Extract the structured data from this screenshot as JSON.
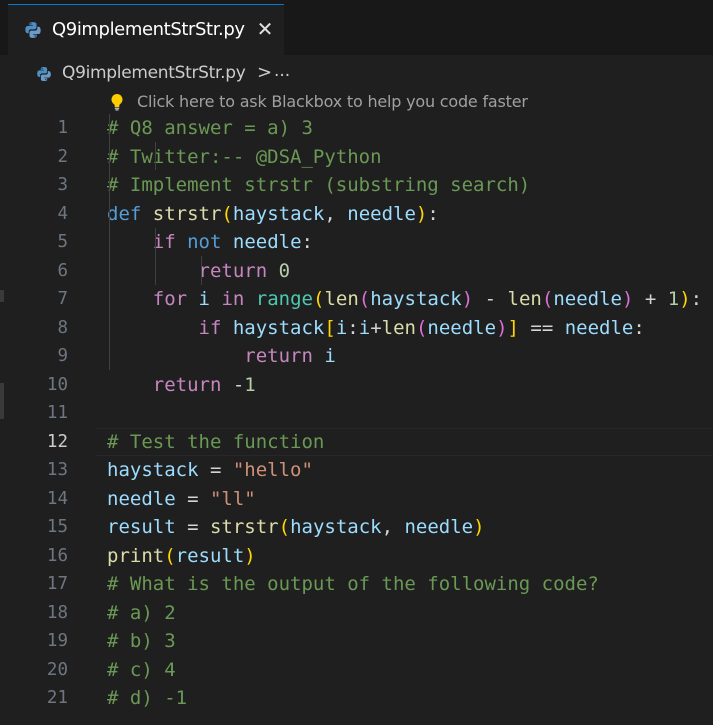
{
  "tab": {
    "filename": "Q9implementStrStr.py",
    "close_glyph": "✕"
  },
  "breadcrumb": {
    "filename": "Q9implementStrStr.py",
    "separator": ">",
    "more": "..."
  },
  "codelens": {
    "text": "Click here to ask Blackbox to help you code faster",
    "icon": "lightbulb-icon"
  },
  "editor": {
    "current_line": 12,
    "lines": [
      {
        "n": "1",
        "tokens": [
          {
            "t": "# Q8 answer = a) 3",
            "c": "cm"
          }
        ]
      },
      {
        "n": "2",
        "tokens": [
          {
            "t": "# Twitter:-- @DSA_Python",
            "c": "cm"
          }
        ]
      },
      {
        "n": "3",
        "tokens": [
          {
            "t": "# Implement strstr (substring search)",
            "c": "cm"
          }
        ]
      },
      {
        "n": "4",
        "tokens": [
          {
            "t": "def",
            "c": "kw"
          },
          {
            "t": " ",
            "c": "tx"
          },
          {
            "t": "strstr",
            "c": "fn"
          },
          {
            "t": "(",
            "c": "b1"
          },
          {
            "t": "haystack",
            "c": "va"
          },
          {
            "t": ", ",
            "c": "tx"
          },
          {
            "t": "needle",
            "c": "va"
          },
          {
            "t": ")",
            "c": "b1"
          },
          {
            "t": ":",
            "c": "tx"
          }
        ]
      },
      {
        "n": "5",
        "tokens": [
          {
            "t": "    ",
            "c": "tx"
          },
          {
            "t": "if",
            "c": "ct"
          },
          {
            "t": " ",
            "c": "tx"
          },
          {
            "t": "not",
            "c": "kw"
          },
          {
            "t": " ",
            "c": "tx"
          },
          {
            "t": "needle",
            "c": "va"
          },
          {
            "t": ":",
            "c": "tx"
          }
        ]
      },
      {
        "n": "6",
        "tokens": [
          {
            "t": "        ",
            "c": "tx"
          },
          {
            "t": "return",
            "c": "ct"
          },
          {
            "t": " ",
            "c": "tx"
          },
          {
            "t": "0",
            "c": "nu"
          }
        ]
      },
      {
        "n": "7",
        "tokens": [
          {
            "t": "    ",
            "c": "tx"
          },
          {
            "t": "for",
            "c": "ct"
          },
          {
            "t": " ",
            "c": "tx"
          },
          {
            "t": "i",
            "c": "va"
          },
          {
            "t": " ",
            "c": "tx"
          },
          {
            "t": "in",
            "c": "ct"
          },
          {
            "t": " ",
            "c": "tx"
          },
          {
            "t": "range",
            "c": "bi"
          },
          {
            "t": "(",
            "c": "b1"
          },
          {
            "t": "len",
            "c": "fn"
          },
          {
            "t": "(",
            "c": "b2"
          },
          {
            "t": "haystack",
            "c": "va"
          },
          {
            "t": ")",
            "c": "b2"
          },
          {
            "t": " - ",
            "c": "tx"
          },
          {
            "t": "len",
            "c": "fn"
          },
          {
            "t": "(",
            "c": "b2"
          },
          {
            "t": "needle",
            "c": "va"
          },
          {
            "t": ")",
            "c": "b2"
          },
          {
            "t": " + ",
            "c": "tx"
          },
          {
            "t": "1",
            "c": "nu"
          },
          {
            "t": ")",
            "c": "b1"
          },
          {
            "t": ":",
            "c": "tx"
          }
        ]
      },
      {
        "n": "8",
        "tokens": [
          {
            "t": "        ",
            "c": "tx"
          },
          {
            "t": "if",
            "c": "ct"
          },
          {
            "t": " ",
            "c": "tx"
          },
          {
            "t": "haystack",
            "c": "va"
          },
          {
            "t": "[",
            "c": "b1"
          },
          {
            "t": "i",
            "c": "va"
          },
          {
            "t": ":",
            "c": "tx"
          },
          {
            "t": "i",
            "c": "va"
          },
          {
            "t": "+",
            "c": "tx"
          },
          {
            "t": "len",
            "c": "fn"
          },
          {
            "t": "(",
            "c": "b2"
          },
          {
            "t": "needle",
            "c": "va"
          },
          {
            "t": ")",
            "c": "b2"
          },
          {
            "t": "]",
            "c": "b1"
          },
          {
            "t": " == ",
            "c": "tx"
          },
          {
            "t": "needle",
            "c": "va"
          },
          {
            "t": ":",
            "c": "tx"
          }
        ]
      },
      {
        "n": "9",
        "tokens": [
          {
            "t": "            ",
            "c": "tx"
          },
          {
            "t": "return",
            "c": "ct"
          },
          {
            "t": " ",
            "c": "tx"
          },
          {
            "t": "i",
            "c": "va"
          }
        ]
      },
      {
        "n": "10",
        "tokens": [
          {
            "t": "    ",
            "c": "tx"
          },
          {
            "t": "return",
            "c": "ct"
          },
          {
            "t": " -",
            "c": "tx"
          },
          {
            "t": "1",
            "c": "nu"
          }
        ]
      },
      {
        "n": "11",
        "tokens": []
      },
      {
        "n": "12",
        "tokens": [
          {
            "t": "# Test the function",
            "c": "cm"
          }
        ]
      },
      {
        "n": "13",
        "tokens": [
          {
            "t": "haystack",
            "c": "va"
          },
          {
            "t": " = ",
            "c": "tx"
          },
          {
            "t": "\"hello\"",
            "c": "st"
          }
        ]
      },
      {
        "n": "14",
        "tokens": [
          {
            "t": "needle",
            "c": "va"
          },
          {
            "t": " = ",
            "c": "tx"
          },
          {
            "t": "\"ll\"",
            "c": "st"
          }
        ]
      },
      {
        "n": "15",
        "tokens": [
          {
            "t": "result",
            "c": "va"
          },
          {
            "t": " = ",
            "c": "tx"
          },
          {
            "t": "strstr",
            "c": "fn"
          },
          {
            "t": "(",
            "c": "b1"
          },
          {
            "t": "haystack",
            "c": "va"
          },
          {
            "t": ", ",
            "c": "tx"
          },
          {
            "t": "needle",
            "c": "va"
          },
          {
            "t": ")",
            "c": "b1"
          }
        ]
      },
      {
        "n": "16",
        "tokens": [
          {
            "t": "print",
            "c": "fn"
          },
          {
            "t": "(",
            "c": "b1"
          },
          {
            "t": "result",
            "c": "va"
          },
          {
            "t": ")",
            "c": "b1"
          }
        ]
      },
      {
        "n": "17",
        "tokens": [
          {
            "t": "# What is the output of the following code?",
            "c": "cm"
          }
        ]
      },
      {
        "n": "18",
        "tokens": [
          {
            "t": "# a) 2",
            "c": "cm"
          }
        ]
      },
      {
        "n": "19",
        "tokens": [
          {
            "t": "# b) 3",
            "c": "cm"
          }
        ]
      },
      {
        "n": "20",
        "tokens": [
          {
            "t": "# c) 4",
            "c": "cm"
          }
        ]
      },
      {
        "n": "21",
        "tokens": [
          {
            "t": "# d) -1",
            "c": "cm"
          }
        ]
      }
    ]
  },
  "colors": {
    "cm": "#6a9955",
    "kw": "#569cd6",
    "ct": "#c586c0",
    "fn": "#dcdcaa",
    "va": "#9cdcfe",
    "bi": "#4ec9b0",
    "nu": "#b5cea8",
    "st": "#ce9178",
    "b1": "#ffd700",
    "b2": "#da70d6",
    "tx": "#d4d4d4"
  }
}
